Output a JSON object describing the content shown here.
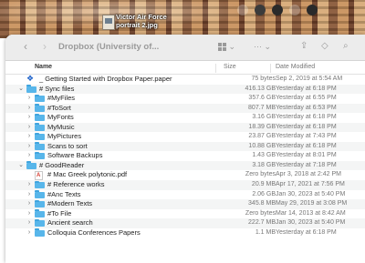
{
  "desktop": {
    "file_label_line1": "Victor Air Force",
    "file_label_line2": "portrait 2.jpg",
    "menubar_icons": [
      "siri-icon",
      "avast-icon",
      "sync-icon",
      "wifi-icon",
      "malwarebytes-icon"
    ]
  },
  "toolbar": {
    "back_symbol": "‹",
    "forward_symbol": "›",
    "title": "Dropbox (University of...",
    "more_symbol": "···",
    "share_symbol": "⇪",
    "tag_symbol": "◇",
    "search_symbol": "⌕"
  },
  "columns": {
    "name": "Name",
    "size": "Size",
    "date": "Date Modified"
  },
  "rows": [
    {
      "name": "_ Getting Started with Dropbox Paper.paper",
      "size": "75 bytes",
      "date": "Sep 2, 2019 at 5:54 AM",
      "icon": "paper",
      "level": 0,
      "chevron": ""
    },
    {
      "name": "# Sync files",
      "size": "416.13 GB",
      "date": "Yesterday at 6:18 PM",
      "icon": "folder",
      "level": 0,
      "chevron": "⌄"
    },
    {
      "name": "#MyFiles",
      "size": "357.6 GB",
      "date": "Yesterday at 6:55 PM",
      "icon": "folder",
      "level": 1,
      "chevron": "›"
    },
    {
      "name": "#ToSort",
      "size": "807.7 MB",
      "date": "Yesterday at 6:53 PM",
      "icon": "folder",
      "level": 1,
      "chevron": "›"
    },
    {
      "name": "MyFonts",
      "size": "3.16 GB",
      "date": "Yesterday at 6:18 PM",
      "icon": "folder",
      "level": 1,
      "chevron": "›"
    },
    {
      "name": "MyMusic",
      "size": "18.39 GB",
      "date": "Yesterday at 6:18 PM",
      "icon": "folder",
      "level": 1,
      "chevron": "›"
    },
    {
      "name": "MyPictures",
      "size": "23.87 GB",
      "date": "Yesterday at 7:43 PM",
      "icon": "folder",
      "level": 1,
      "chevron": "›"
    },
    {
      "name": "Scans to sort",
      "size": "10.88 GB",
      "date": "Yesterday at 6:18 PM",
      "icon": "folder",
      "level": 1,
      "chevron": "›"
    },
    {
      "name": "Software Backups",
      "size": "1.43 GB",
      "date": "Yesterday at 8:01 PM",
      "icon": "folder",
      "level": 1,
      "chevron": "›"
    },
    {
      "name": "# GoodReader",
      "size": "3.18 GB",
      "date": "Yesterday at 7:18 PM",
      "icon": "folder",
      "level": 0,
      "chevron": "⌄"
    },
    {
      "name": "# Mac Greek polytonic.pdf",
      "size": "Zero bytes",
      "date": "Apr 3, 2018 at 2:42 PM",
      "icon": "pdf",
      "level": 1,
      "chevron": ""
    },
    {
      "name": "# Reference works",
      "size": "20.9 MB",
      "date": "Apr 17, 2021 at 7:56 PM",
      "icon": "folder",
      "level": 1,
      "chevron": "›"
    },
    {
      "name": "#Anc Texts",
      "size": "2.06 GB",
      "date": "Jan 30, 2023 at 5:40 PM",
      "icon": "folder",
      "level": 1,
      "chevron": "›"
    },
    {
      "name": "#Modern Texts",
      "size": "345.8 MB",
      "date": "May 29, 2019 at 3:08 PM",
      "icon": "folder",
      "level": 1,
      "chevron": "›"
    },
    {
      "name": "#To File",
      "size": "Zero bytes",
      "date": "Mar 14, 2013 at 8:42 AM",
      "icon": "folder",
      "level": 1,
      "chevron": "›"
    },
    {
      "name": "Ancient search",
      "size": "222.7 MB",
      "date": "Jan 30, 2023 at 5:40 PM",
      "icon": "folder",
      "level": 1,
      "chevron": "›"
    },
    {
      "name": "Colloquia Conferences Papers",
      "size": "1.1 MB",
      "date": "Yesterday at 6:18 PM",
      "icon": "folder",
      "level": 1,
      "chevron": "›"
    }
  ]
}
